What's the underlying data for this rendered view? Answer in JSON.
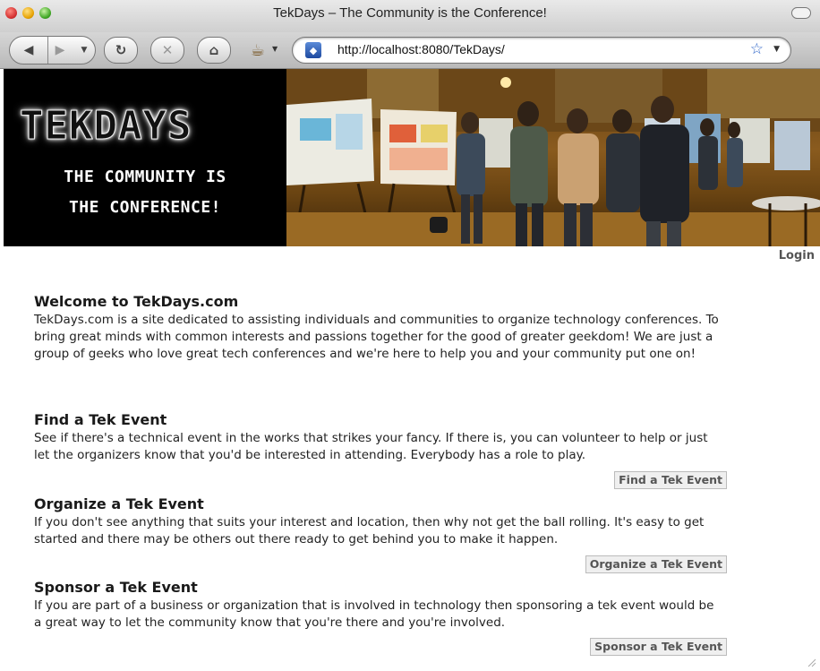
{
  "window": {
    "title": "TekDays – The Community is the Conference!"
  },
  "toolbar": {
    "url": "http://localhost:8080/TekDays/"
  },
  "icons": {
    "back": "back-arrow-icon",
    "forward": "forward-arrow-icon",
    "reload": "reload-icon",
    "stop": "stop-icon",
    "home": "home-icon",
    "coffee": "coffee-cup-icon",
    "bookmark": "star-icon"
  },
  "banner": {
    "logo": "TEKDAYS",
    "tagline_line1": "THE COMMUNITY IS",
    "tagline_line2": "THE CONFERENCE!"
  },
  "nav": {
    "login": "Login"
  },
  "sections": {
    "welcome": {
      "title": "Welcome to TekDays.com",
      "text": "TekDays.com is a site dedicated to assisting individuals and communities to organize technology conferences. To bring great minds with common interests and passions together for the good of greater geekdom! We are just a group of geeks who love great tech conferences and we're here to help you and your community put one on!"
    },
    "find": {
      "title": "Find a Tek Event",
      "text": "See if there's a technical event in the works that strikes your fancy. If there is, you can volunteer to help or just let the organizers know that you'd be interested in attending. Everybody has a role to play.",
      "button": "Find a Tek Event"
    },
    "organize": {
      "title": "Organize a Tek Event",
      "text": "If you don't see anything that suits your interest and location, then why not get the ball rolling. It's easy to get started and there may be others out there ready to get behind you to make it happen.",
      "button": "Organize a Tek Event"
    },
    "sponsor": {
      "title": "Sponsor a Tek Event",
      "text": "If you are part of a business or organization that is involved in technology then sponsoring a tek event would be a great way to let the community know that you're there and you're involved.",
      "button": "Sponsor a Tek Event"
    }
  }
}
